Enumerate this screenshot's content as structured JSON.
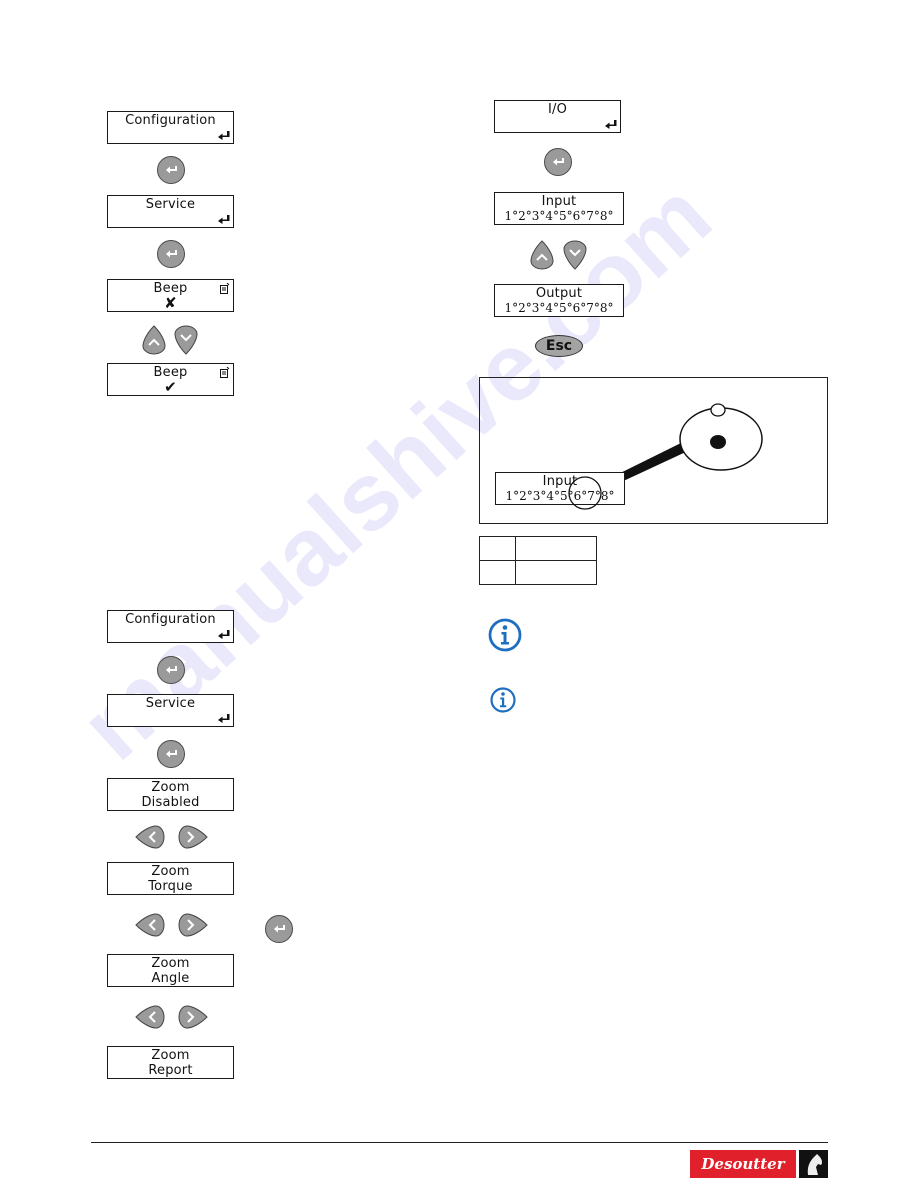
{
  "left_column": {
    "procedure_beep": {
      "screens": [
        {
          "line1": "Configuration",
          "line2": "",
          "icon": "enter-icon"
        },
        {
          "line1": "Service",
          "line2": "",
          "icon": "enter-icon"
        },
        {
          "line1": "Beep",
          "mark": "✘",
          "icon": "menu-edit-icon"
        },
        {
          "line1": "Beep",
          "mark": "✔",
          "icon": "menu-edit-icon"
        }
      ],
      "keys": [
        "enter-key",
        "enter-key",
        "up-down-keys"
      ]
    },
    "procedure_zoom": {
      "screens": [
        {
          "line1": "Configuration",
          "line2": "",
          "icon": "enter-icon"
        },
        {
          "line1": "Service",
          "line2": "",
          "icon": "enter-icon"
        },
        {
          "line1": "Zoom",
          "line2": "Disabled"
        },
        {
          "line1": "Zoom",
          "line2": "Torque"
        },
        {
          "line1": "Zoom",
          "line2": "Angle"
        },
        {
          "line1": "Zoom",
          "line2": "Report"
        }
      ],
      "keys": [
        "enter-key",
        "enter-key",
        "left-right-keys",
        "left-right-keys + enter-key",
        "left-right-keys"
      ]
    }
  },
  "right_column": {
    "procedure_io": {
      "screens": [
        {
          "line1": "I/O",
          "line2": "",
          "icon": "enter-icon"
        },
        {
          "line1": "Input",
          "digits": "1°2°3°4°5°6°7°8°"
        },
        {
          "line1": "Output",
          "digits": "1°2°3°4°5°6°7°8°"
        }
      ],
      "keys": [
        "enter-key",
        "up-down-keys",
        "esc-key"
      ],
      "esc_label": "Esc"
    },
    "figure": {
      "screen": {
        "line1": "Input",
        "digits": "1°2°3°4°5°6°7°8°"
      },
      "magnified_states": [
        "open-circle",
        "filled-circle"
      ]
    },
    "legend_table": {
      "rows": [
        [
          "",
          ""
        ],
        [
          "",
          ""
        ]
      ]
    },
    "notes": [
      {
        "icon": "info-icon"
      },
      {
        "icon": "info-icon"
      }
    ]
  },
  "footer": {
    "brand": "Desoutter",
    "brand_color": "#e0202a"
  },
  "watermark": "manualshive.com"
}
